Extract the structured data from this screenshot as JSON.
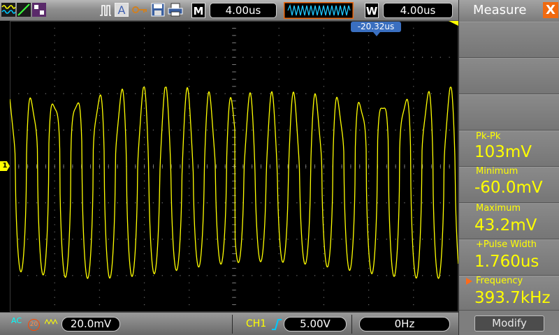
{
  "toolbar": {
    "timebase_label": "M",
    "timebase_value": "4.00us",
    "window_label": "W",
    "window_value": "4.00us"
  },
  "screen": {
    "trigger_position": "-20.32us",
    "channel_marker": "1"
  },
  "status": {
    "coupling": "AC",
    "bandwidth_limit": "20",
    "ch1_scale": "20.0mV",
    "trigger_source": "CH1",
    "trigger_level": "5.00V",
    "frequency_readout": "0Hz"
  },
  "panel": {
    "title": "Measure",
    "close_glyph": "X",
    "measurements": [
      {
        "label": "Pk-Pk",
        "value": "103mV"
      },
      {
        "label": "Minimum",
        "value": "-60.0mV"
      },
      {
        "label": "Maximum",
        "value": "43.2mV"
      },
      {
        "label": "+Pulse Width",
        "value": "1.760us"
      },
      {
        "label": "Frequency",
        "value": "393.7kHz"
      }
    ],
    "modify_label": "Modify"
  },
  "colors": {
    "trace": "#ffff00",
    "accent": "#f06a10",
    "trigger_marker": "#3a6fc0"
  },
  "icons": [
    "waveform-icon",
    "line-icon",
    "display-icon",
    "run-stop-icon",
    "auto-icon",
    "key-icon",
    "save-icon",
    "print-icon",
    "rising-edge-icon",
    "close-icon"
  ]
}
